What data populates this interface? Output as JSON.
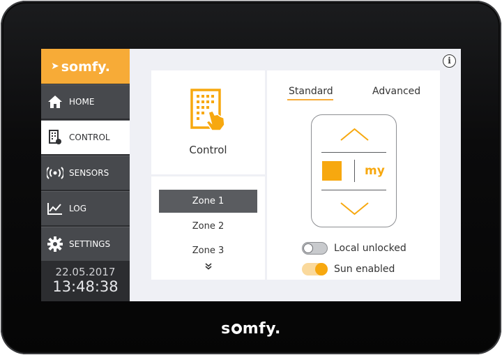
{
  "bezel": {
    "logo": "somfy."
  },
  "sidebar": {
    "brand": "somfy.",
    "items": [
      {
        "label": "HOME",
        "icon": "home-icon"
      },
      {
        "label": "CONTROL",
        "icon": "control-icon",
        "active": true
      },
      {
        "label": "SENSORS",
        "icon": "sensors-icon"
      },
      {
        "label": "LOG",
        "icon": "log-icon"
      },
      {
        "label": "SETTINGS",
        "icon": "gear-icon"
      }
    ],
    "date": "22.05.2017",
    "time": "13:48:38"
  },
  "control_card": {
    "label": "Control",
    "icon": "building-touch-icon"
  },
  "zones": {
    "items": [
      "Zone 1",
      "Zone 2",
      "Zone 3"
    ],
    "selected": "Zone 1",
    "more_icon": "double-chevron-down-icon"
  },
  "tabs": {
    "standard": "Standard",
    "advanced": "Advanced",
    "active": "Standard"
  },
  "remote": {
    "my_label": "my"
  },
  "toggles": {
    "local": {
      "label": "Local unlocked",
      "state": "off"
    },
    "sun": {
      "label": "Sun enabled",
      "state": "on"
    }
  },
  "info": {
    "icon": "info-icon",
    "glyph": "i"
  },
  "colors": {
    "accent": "#f7ab37",
    "sidebar_bg": "#2c2d30",
    "nav_bg": "#47494d",
    "selected_zone": "#5a5c60"
  }
}
